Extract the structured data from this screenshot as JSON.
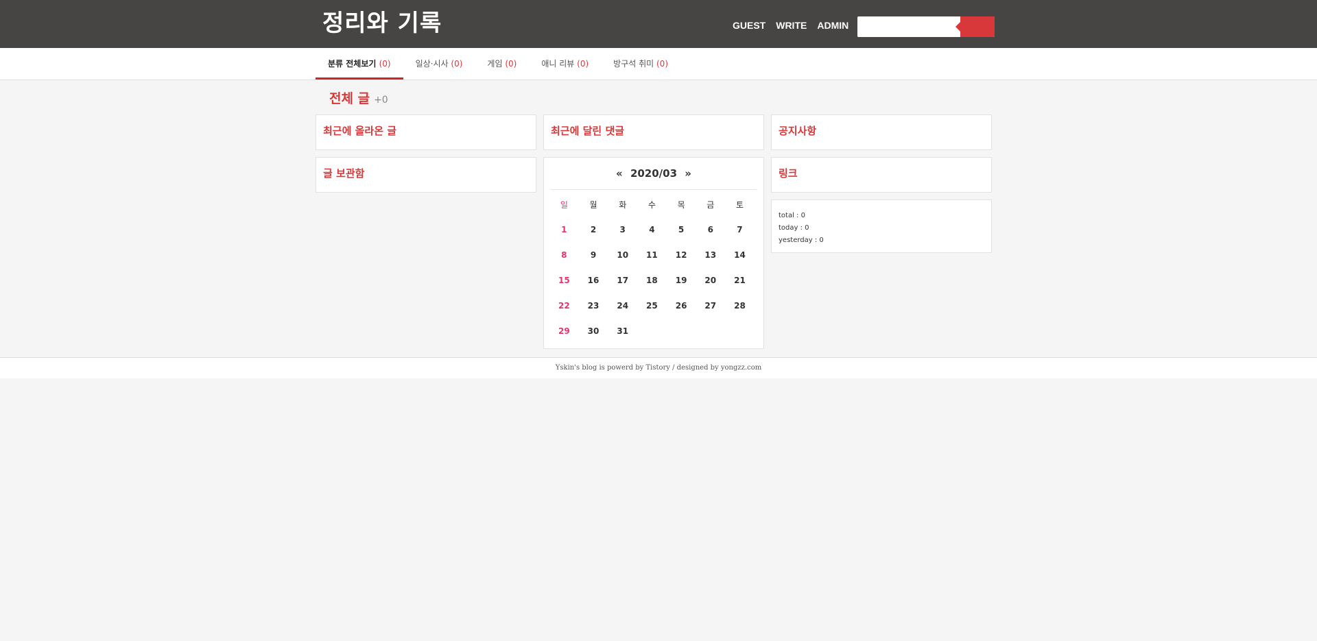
{
  "header": {
    "title": "정리와 기록",
    "links": [
      "GUEST",
      "WRITE",
      "ADMIN"
    ],
    "search": {
      "placeholder": "",
      "value": ""
    },
    "colors": {
      "background": "#474543",
      "accent": "#d9383a"
    }
  },
  "nav": {
    "items": [
      {
        "label": "분류 전체보기",
        "count": "(0)",
        "active": true
      },
      {
        "label": "일상·시사",
        "count": "(0)",
        "active": false
      },
      {
        "label": "게임",
        "count": "(0)",
        "active": false
      },
      {
        "label": "애니 리뷰",
        "count": "(0)",
        "active": false
      },
      {
        "label": "방구석 취미",
        "count": "(0)",
        "active": false
      }
    ]
  },
  "main": {
    "heading": "전체 글",
    "heading_count": "+0"
  },
  "widgets": {
    "recent_posts": "최근에 올라온 글",
    "recent_comments": "최근에 달린 댓글",
    "notice": "공지사항",
    "archive": "글 보관함",
    "links": "링크"
  },
  "calendar": {
    "prev": "«",
    "next": "»",
    "month": "2020/03",
    "weekdays": [
      "일",
      "월",
      "화",
      "수",
      "목",
      "금",
      "토"
    ],
    "weeks": [
      [
        "1",
        "2",
        "3",
        "4",
        "5",
        "6",
        "7"
      ],
      [
        "8",
        "9",
        "10",
        "11",
        "12",
        "13",
        "14"
      ],
      [
        "15",
        "16",
        "17",
        "18",
        "19",
        "20",
        "21"
      ],
      [
        "22",
        "23",
        "24",
        "25",
        "26",
        "27",
        "28"
      ],
      [
        "29",
        "30",
        "31",
        "",
        "",
        "",
        ""
      ]
    ]
  },
  "counter": {
    "total": "total : 0",
    "today": "today : 0",
    "yesterday": "yesterday : 0"
  },
  "footer": {
    "text": "Yskin's blog is powerd by Tistory / designed by yongzz.com"
  }
}
